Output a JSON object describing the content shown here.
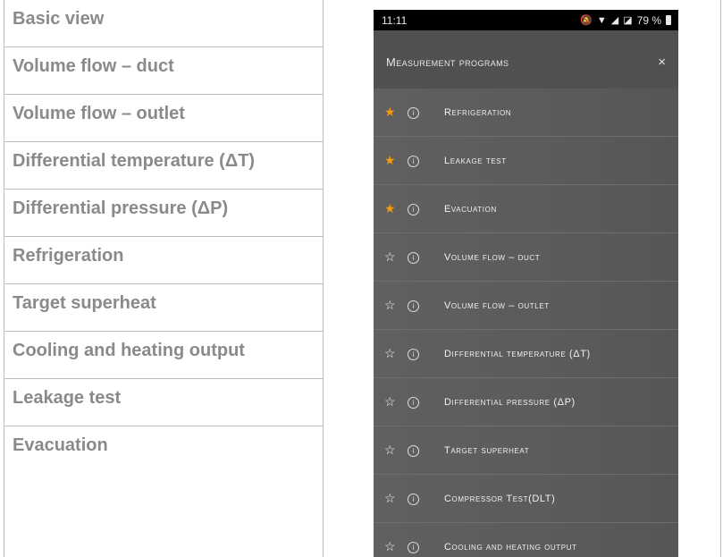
{
  "left_table": {
    "rows": [
      "Basic view",
      "Volume flow – duct",
      "Volume flow – outlet",
      "Differential temperature (ΔT)",
      "Differential pressure (ΔP)",
      "Refrigeration",
      "Target superheat",
      "Cooling and heating output",
      "Leakage test",
      "Evacuation"
    ]
  },
  "phone": {
    "status_bar": {
      "time": "11:11",
      "battery": "79 %"
    },
    "header": {
      "title": "Measurement programs",
      "close": "×"
    },
    "items": [
      {
        "label": "Refrigeration",
        "favorite": true
      },
      {
        "label": "Leakage test",
        "favorite": true
      },
      {
        "label": "Evacuation",
        "favorite": true
      },
      {
        "label": "Volume flow – duct",
        "favorite": false
      },
      {
        "label": "Volume flow – outlet",
        "favorite": false
      },
      {
        "label": "Differential temperature (ΔT)",
        "favorite": false
      },
      {
        "label": "Differential pressure (ΔP)",
        "favorite": false
      },
      {
        "label": "Target superheat",
        "favorite": false
      },
      {
        "label": "Compressor Test(DLT)",
        "favorite": false
      },
      {
        "label": "Cooling and heating output",
        "favorite": false
      }
    ]
  },
  "icons": {
    "favorite": "star-filled-icon",
    "not_favorite": "star-outline-icon",
    "info": "info-icon"
  },
  "colors": {
    "favorite_star": "#f39c12"
  }
}
